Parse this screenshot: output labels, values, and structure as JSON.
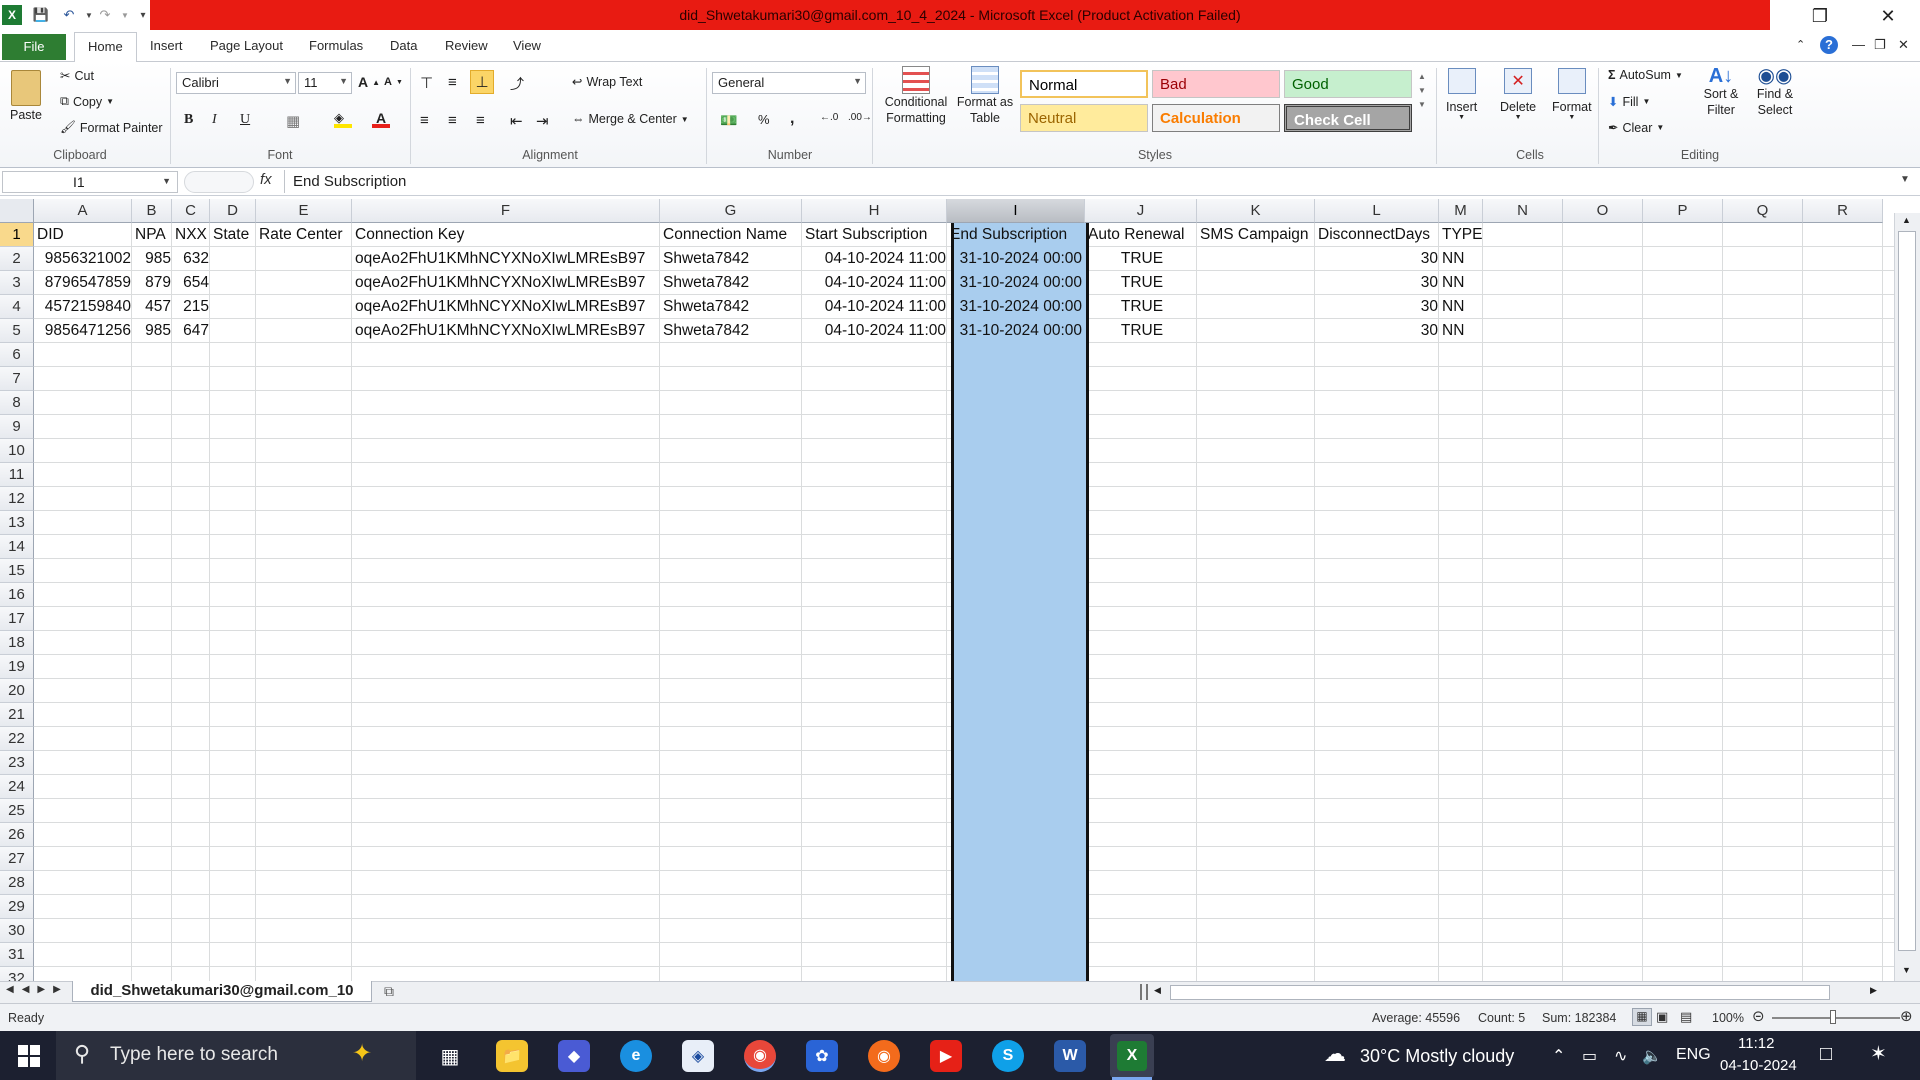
{
  "window": {
    "title": "did_Shwetakumari30@gmail.com_10_4_2024  -  Microsoft Excel (Product Activation Failed)"
  },
  "ribbon": {
    "tabs": [
      "File",
      "Home",
      "Insert",
      "Page Layout",
      "Formulas",
      "Data",
      "Review",
      "View"
    ],
    "active_tab": "Home",
    "clipboard": {
      "paste": "Paste",
      "cut": "Cut",
      "copy": "Copy",
      "format_painter": "Format Painter",
      "label": "Clipboard"
    },
    "font": {
      "name": "Calibri",
      "size": "11",
      "bold": "B",
      "italic": "I",
      "underline": "U",
      "label": "Font"
    },
    "alignment": {
      "wrap_text": "Wrap Text",
      "merge_center": "Merge & Center",
      "label": "Alignment"
    },
    "number": {
      "format": "General",
      "percent": "%",
      "comma": ",",
      "label": "Number"
    },
    "styles": {
      "conditional_formatting": "Conditional Formatting",
      "format_as_table": "Format as Table",
      "normal": "Normal",
      "bad": "Bad",
      "good": "Good",
      "neutral": "Neutral",
      "calculation": "Calculation",
      "check_cell": "Check Cell",
      "label": "Styles"
    },
    "cells": {
      "insert": "Insert",
      "delete": "Delete",
      "format": "Format",
      "label": "Cells"
    },
    "editing": {
      "autosum": "AutoSum",
      "fill": "Fill",
      "clear": "Clear",
      "sort_filter": "Sort & Filter",
      "find_select": "Find & Select",
      "label": "Editing"
    }
  },
  "formula_bar": {
    "name_box": "I1",
    "fx": "fx",
    "content": "End Subscription"
  },
  "columns": [
    "A",
    "B",
    "C",
    "D",
    "E",
    "F",
    "G",
    "H",
    "I",
    "J",
    "K",
    "L",
    "M",
    "N",
    "O",
    "P",
    "Q",
    "R"
  ],
  "rows": [
    "1",
    "2",
    "3",
    "4",
    "5",
    "6",
    "7",
    "8",
    "9",
    "10",
    "11",
    "12",
    "13",
    "14",
    "15",
    "16",
    "17",
    "18",
    "19",
    "20",
    "21",
    "22",
    "23",
    "24",
    "25",
    "26",
    "27",
    "28",
    "29",
    "30",
    "31",
    "32"
  ],
  "headers": [
    "DID",
    "NPA",
    "NXX",
    "State",
    "Rate Center",
    "Connection Key",
    "Connection Name",
    "Start Subscription",
    "End Subscription",
    "Auto Renewal",
    "SMS Campaign",
    "DisconnectDays",
    "TYPE"
  ],
  "data_rows": [
    [
      "9856321002",
      "985",
      "632",
      "",
      "",
      "oqeAo2FhU1KMhNCYXNoXIwLMREsB97",
      "Shweta7842",
      "04-10-2024 11:00",
      "31-10-2024 00:00",
      "TRUE",
      "",
      "30",
      "NN"
    ],
    [
      "8796547859",
      "879",
      "654",
      "",
      "",
      "oqeAo2FhU1KMhNCYXNoXIwLMREsB97",
      "Shweta7842",
      "04-10-2024 11:00",
      "31-10-2024 00:00",
      "TRUE",
      "",
      "30",
      "NN"
    ],
    [
      "4572159840",
      "457",
      "215",
      "",
      "",
      "oqeAo2FhU1KMhNCYXNoXIwLMREsB97",
      "Shweta7842",
      "04-10-2024 11:00",
      "31-10-2024 00:00",
      "TRUE",
      "",
      "30",
      "NN"
    ],
    [
      "9856471256",
      "985",
      "647",
      "",
      "",
      "oqeAo2FhU1KMhNCYXNoXIwLMREsB97",
      "Shweta7842",
      "04-10-2024 11:00",
      "31-10-2024 00:00",
      "TRUE",
      "",
      "30",
      "NN"
    ]
  ],
  "sheet_tab": "did_Shwetakumari30@gmail.com_10",
  "status": {
    "ready": "Ready",
    "average": "Average: 45596",
    "count": "Count: 5",
    "sum": "Sum: 182384",
    "zoom": "100%"
  },
  "taskbar": {
    "search_placeholder": "Type here to search",
    "weather": "30°C  Mostly cloudy",
    "language": "ENG",
    "time": "11:12",
    "date": "04-10-2024"
  }
}
